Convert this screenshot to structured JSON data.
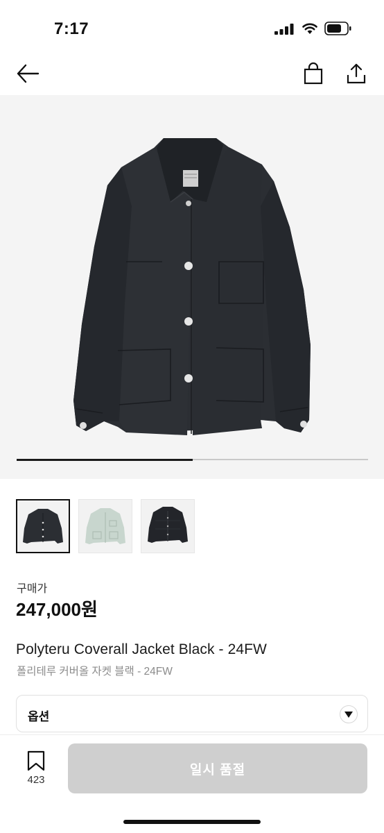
{
  "status_bar": {
    "time": "7:17"
  },
  "nav": {
    "back_icon": "arrow-left-icon",
    "bag_icon": "shopping-bag-icon",
    "share_icon": "share-icon"
  },
  "gallery": {
    "progress_fraction": 0.5,
    "thumbnails": [
      {
        "name": "black-coverall",
        "color": "#2a2d31",
        "selected": true
      },
      {
        "name": "mint-coverall",
        "color": "#c9d6cf",
        "selected": false
      },
      {
        "name": "black-quilted-jacket",
        "color": "#23252a",
        "selected": false
      }
    ]
  },
  "price": {
    "label": "구매가",
    "value": "247,000원"
  },
  "product": {
    "name": "Polyteru Coverall Jacket Black - 24FW",
    "name_ko": "폴리테루 커버올 자켓 블랙 - 24FW"
  },
  "option": {
    "label": "옵션",
    "icon": "chevron-down-icon"
  },
  "bottom_bar": {
    "bookmark_icon": "bookmark-icon",
    "bookmark_count": "423",
    "action_label": "일시 품절"
  },
  "colors": {
    "jacket": "#2b2e33",
    "hero_bg": "#f4f4f4",
    "disabled_button": "#cfcfcf"
  }
}
